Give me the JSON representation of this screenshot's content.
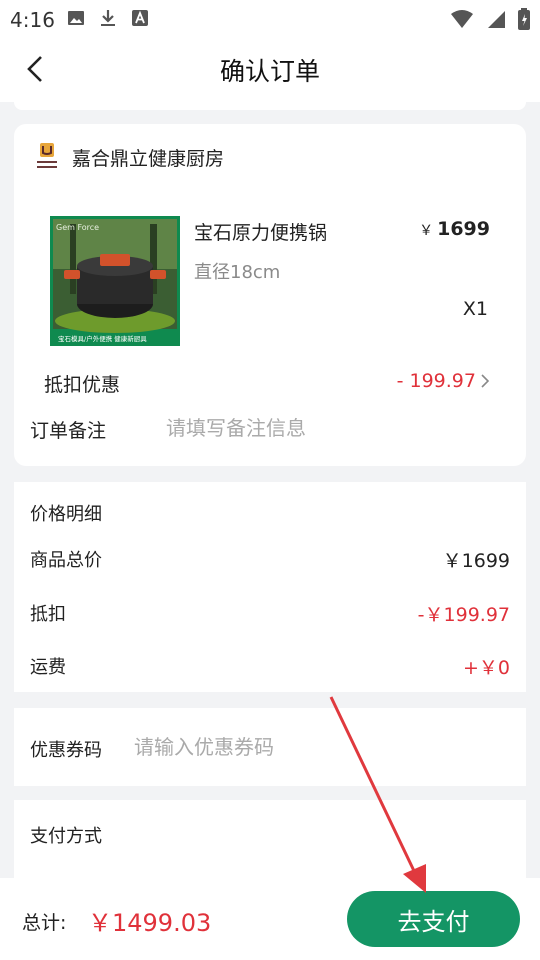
{
  "status_bar": {
    "time": "4:16"
  },
  "nav": {
    "title": "确认订单"
  },
  "store": {
    "name": "嘉合鼎立健康厨房",
    "product": {
      "name": "宝石原力便携锅",
      "spec": "直径18cm",
      "price_symbol": "￥",
      "price": "1699",
      "quantity": "X1",
      "image_caption_top": "Gem Force",
      "image_caption_bottom": "宝石模具/户外便携 健康新厨具"
    },
    "discount_label": "抵扣优惠",
    "discount_value": "- 199.97",
    "remark_label": "订单备注",
    "remark_placeholder": "请填写备注信息"
  },
  "price_detail": {
    "title": "价格明细",
    "rows": [
      {
        "label": "商品总价",
        "value": "￥1699",
        "color": "#222222"
      },
      {
        "label": "抵扣",
        "value": "-￥199.97",
        "color": "#e0313a"
      },
      {
        "label": "运费",
        "value": "+￥0",
        "color": "#e0313a"
      }
    ]
  },
  "coupon": {
    "label": "优惠券码",
    "placeholder": "请输入优惠券码"
  },
  "payment": {
    "label": "支付方式"
  },
  "footer": {
    "total_label": "总计:",
    "total_value": "￥1499.03",
    "pay_button": "去支付"
  },
  "colors": {
    "accent_green": "#149565",
    "price_red": "#e0313a",
    "annotation_arrow": "#e0393e"
  }
}
